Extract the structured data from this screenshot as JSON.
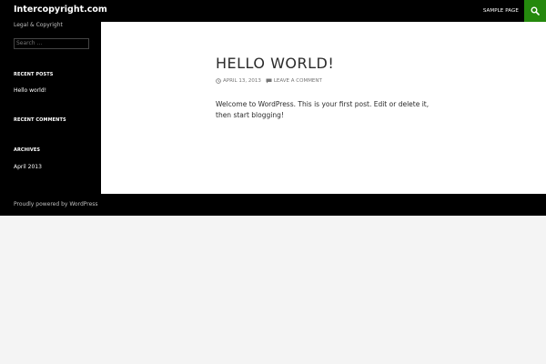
{
  "header": {
    "site_title": "Intercopyright.com",
    "nav_item": "SAMPLE PAGE",
    "search_icon": "search-icon",
    "search_toggle_color": "#24890d"
  },
  "sidebar": {
    "tagline": "Legal & Copyright",
    "search_placeholder": "Search ...",
    "recent_posts_title": "RECENT POSTS",
    "recent_posts": [
      "Hello world!"
    ],
    "recent_comments_title": "RECENT COMMENTS",
    "archives_title": "ARCHIVES",
    "archives": [
      "April 2013"
    ]
  },
  "post": {
    "title": "HELLO WORLD!",
    "date": "APRIL 13, 2013",
    "date_icon": "clock-icon",
    "comment_link": "LEAVE A COMMENT",
    "comment_icon": "comment-icon",
    "body": "Welcome to WordPress. This is your first post. Edit or delete it, then start blogging!"
  },
  "footer": {
    "credit": "Proudly powered by WordPress"
  },
  "colors": {
    "accent": "#24890d",
    "background": "#f4f4f4",
    "header_bg": "#000000"
  }
}
